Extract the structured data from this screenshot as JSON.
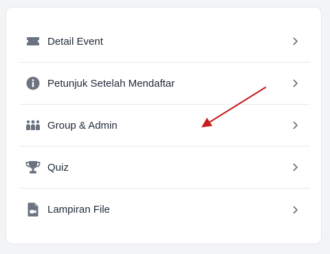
{
  "colors": {
    "icon": "#6b7280",
    "chevron": "#6b7280",
    "arrow": "#c81e1e",
    "divider": "#e5e7eb"
  },
  "menu": {
    "items": [
      {
        "label": "Detail Event",
        "icon": "ticket-icon"
      },
      {
        "label": "Petunjuk Setelah Mendaftar",
        "icon": "info-circle-icon"
      },
      {
        "label": "Group & Admin",
        "icon": "people-group-icon"
      },
      {
        "label": "Quiz",
        "icon": "trophy-icon"
      },
      {
        "label": "Lampiran File",
        "icon": "file-video-icon"
      }
    ]
  }
}
